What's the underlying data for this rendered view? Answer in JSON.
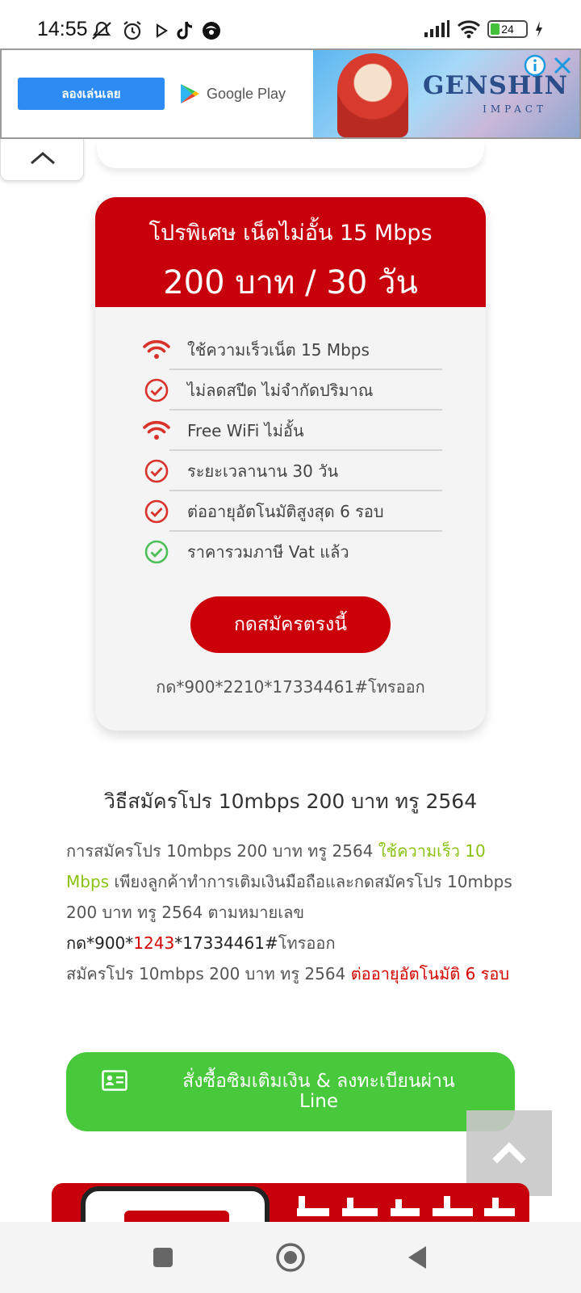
{
  "status_bar": {
    "time": "14:55",
    "battery": "24",
    "icons": [
      "dnd-icon",
      "alarm-icon",
      "play-icon",
      "tiktok-icon",
      "browser-icon",
      "signal-icon",
      "wifi-icon",
      "battery-icon",
      "charging-icon"
    ]
  },
  "ad": {
    "cta_label": "ลองเล่นเลย",
    "store_label": "Google Play",
    "game_logo": "GENSHIN",
    "game_logo_sub": "IMPACT"
  },
  "promo": {
    "title": "โปรพิเศษ เน็ตไม่อั้น 15 Mbps",
    "price": "200 บาท / 30 วัน",
    "features": [
      {
        "icon": "wifi-icon",
        "text": "ใช้ความเร็วเน็ต 15 Mbps",
        "color": "#d9322b"
      },
      {
        "icon": "check-circle-icon",
        "text": "ไม่ลดสปีด ไม่จำกัดปริมาณ",
        "color": "#d9322b"
      },
      {
        "icon": "wifi-icon",
        "text": "Free WiFi ไม่อั้น",
        "color": "#d9322b"
      },
      {
        "icon": "check-circle-icon",
        "text": "ระยะเวลานาน 30 วัน",
        "color": "#d9322b"
      },
      {
        "icon": "check-circle-icon",
        "text": "ต่ออายุอัตโนมัติสูงสุด 6 รอบ",
        "color": "#d9322b"
      },
      {
        "icon": "check-circle-icon",
        "text": "ราคารวมภาษี Vat แล้ว",
        "color": "#4cbf56"
      }
    ],
    "cta_label": "กดสมัครตรงนี้",
    "ussd": "กด*900*2210*17334461#โทรออก"
  },
  "article": {
    "heading": "วิธีสมัครโปร 10mbps 200 บาท ทรู 2564",
    "p1": "การสมัครโปร 10mbps 200 บาท ทรู 2564 ",
    "p1_green": "ใช้ความเร็ว 10 Mbps",
    "p1_rest": " เพียงลูกค้าทำการเติมเงินมือถือและกดสมัครโปร 10mbps 200 บาท ทรู 2564 ตามหมายเลข",
    "code_pre": "กด*900*",
    "code_red": "1243",
    "code_post": "*17334461#",
    "code_tail": "โทรออก",
    "p2": "สมัครโปร 10mbps 200 บาท ทรู 2564 ",
    "p2_red": "ต่ออายุอัตโนมัติ 6 รอบ"
  },
  "line_button": {
    "line1": "สั่งซื้อซิมเติมเงิน & ลงทะเบียนผ่าน",
    "line2": "Line"
  },
  "colors": {
    "brand_red": "#c8000c",
    "line_green": "#47c93b",
    "accent_green": "#8bc211"
  }
}
